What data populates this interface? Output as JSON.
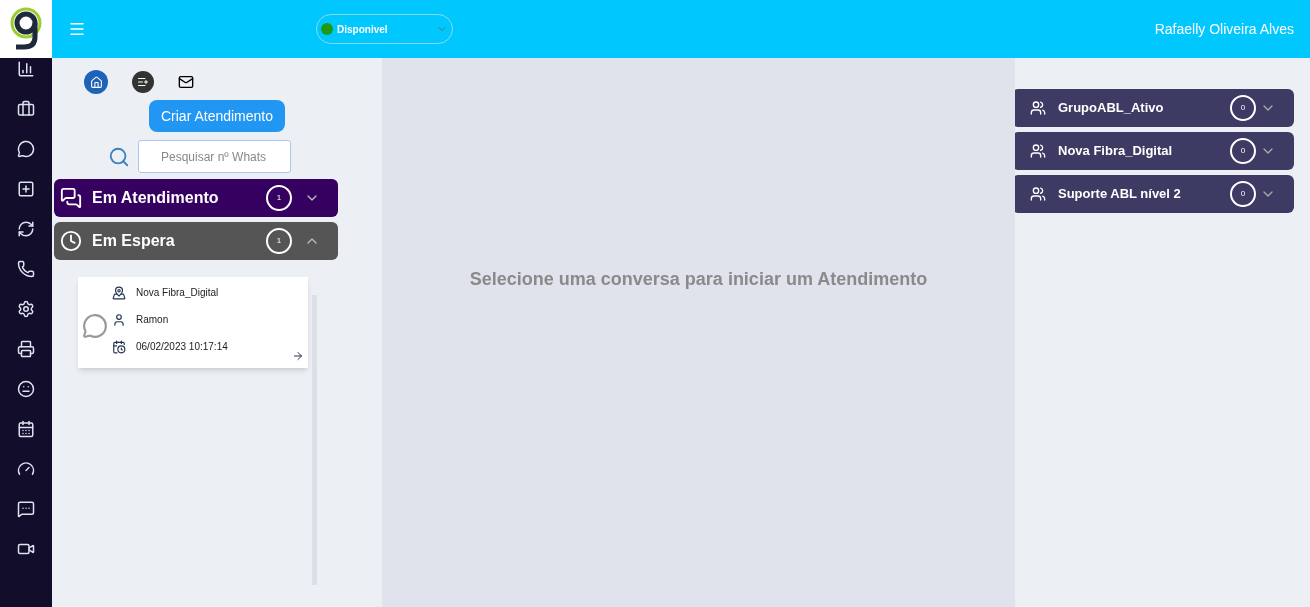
{
  "header": {
    "status": {
      "label": "Disponivel",
      "color": "#1f9a12"
    },
    "user_name": "Rafaelly Oliveira Alves"
  },
  "toolbar": {
    "create_button": "Criar Atendimento",
    "search": {
      "placeholder": "Pesquisar nº Whats"
    }
  },
  "sections": [
    {
      "kind": "chat",
      "title": "Em Atendimento",
      "count": "1",
      "expanded": false,
      "color": "#360061"
    },
    {
      "kind": "wait",
      "title": "Em Espera",
      "count": "1",
      "expanded": true,
      "color": "#555555"
    }
  ],
  "queue_cards": [
    {
      "group": "Nova Fibra_Digital",
      "agent": "Ramon",
      "datetime": "06/02/2023 10:17:14"
    }
  ],
  "main": {
    "message": "Selecione uma conversa para iniciar um Atendimento"
  },
  "groups": [
    {
      "name": "GrupoABL_Ativo",
      "count": "0",
      "expanded": false
    },
    {
      "name": "Nova Fibra_Digital",
      "count": "0",
      "expanded": false
    },
    {
      "name": "Suporte ABL nível 2",
      "count": "0",
      "expanded": false
    }
  ]
}
